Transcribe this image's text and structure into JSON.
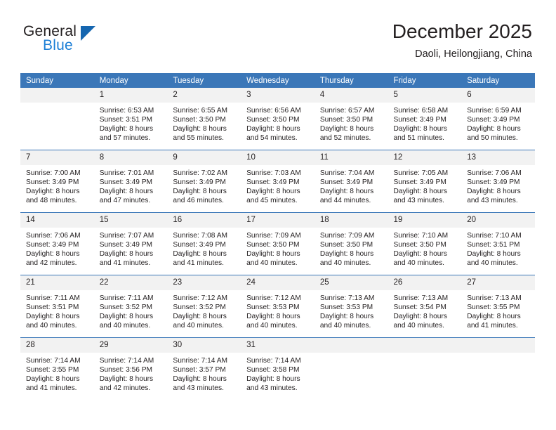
{
  "brand": {
    "name_part1": "General",
    "name_part2": "Blue",
    "accent_color": "#1c7fd6",
    "triangle_color": "#1566b0"
  },
  "header": {
    "title": "December 2025",
    "subtitle": "Daoli, Heilongjiang, China"
  },
  "theme": {
    "header_row_color": "#3b77b8",
    "daynum_band_color": "#f2f2f2",
    "text_color": "#231f20"
  },
  "weekdays": [
    "Sunday",
    "Monday",
    "Tuesday",
    "Wednesday",
    "Thursday",
    "Friday",
    "Saturday"
  ],
  "labels": {
    "sunrise_prefix": "Sunrise:",
    "sunset_prefix": "Sunset:",
    "daylight_prefix": "Daylight:"
  },
  "weeks": [
    [
      {
        "day": "",
        "blank": true
      },
      {
        "day": "1",
        "line1": "Sunrise: 6:53 AM",
        "line2": "Sunset: 3:51 PM",
        "line3": "Daylight: 8 hours",
        "line4": "and 57 minutes."
      },
      {
        "day": "2",
        "line1": "Sunrise: 6:55 AM",
        "line2": "Sunset: 3:50 PM",
        "line3": "Daylight: 8 hours",
        "line4": "and 55 minutes."
      },
      {
        "day": "3",
        "line1": "Sunrise: 6:56 AM",
        "line2": "Sunset: 3:50 PM",
        "line3": "Daylight: 8 hours",
        "line4": "and 54 minutes."
      },
      {
        "day": "4",
        "line1": "Sunrise: 6:57 AM",
        "line2": "Sunset: 3:50 PM",
        "line3": "Daylight: 8 hours",
        "line4": "and 52 minutes."
      },
      {
        "day": "5",
        "line1": "Sunrise: 6:58 AM",
        "line2": "Sunset: 3:49 PM",
        "line3": "Daylight: 8 hours",
        "line4": "and 51 minutes."
      },
      {
        "day": "6",
        "line1": "Sunrise: 6:59 AM",
        "line2": "Sunset: 3:49 PM",
        "line3": "Daylight: 8 hours",
        "line4": "and 50 minutes."
      }
    ],
    [
      {
        "day": "7",
        "line1": "Sunrise: 7:00 AM",
        "line2": "Sunset: 3:49 PM",
        "line3": "Daylight: 8 hours",
        "line4": "and 48 minutes."
      },
      {
        "day": "8",
        "line1": "Sunrise: 7:01 AM",
        "line2": "Sunset: 3:49 PM",
        "line3": "Daylight: 8 hours",
        "line4": "and 47 minutes."
      },
      {
        "day": "9",
        "line1": "Sunrise: 7:02 AM",
        "line2": "Sunset: 3:49 PM",
        "line3": "Daylight: 8 hours",
        "line4": "and 46 minutes."
      },
      {
        "day": "10",
        "line1": "Sunrise: 7:03 AM",
        "line2": "Sunset: 3:49 PM",
        "line3": "Daylight: 8 hours",
        "line4": "and 45 minutes."
      },
      {
        "day": "11",
        "line1": "Sunrise: 7:04 AM",
        "line2": "Sunset: 3:49 PM",
        "line3": "Daylight: 8 hours",
        "line4": "and 44 minutes."
      },
      {
        "day": "12",
        "line1": "Sunrise: 7:05 AM",
        "line2": "Sunset: 3:49 PM",
        "line3": "Daylight: 8 hours",
        "line4": "and 43 minutes."
      },
      {
        "day": "13",
        "line1": "Sunrise: 7:06 AM",
        "line2": "Sunset: 3:49 PM",
        "line3": "Daylight: 8 hours",
        "line4": "and 43 minutes."
      }
    ],
    [
      {
        "day": "14",
        "line1": "Sunrise: 7:06 AM",
        "line2": "Sunset: 3:49 PM",
        "line3": "Daylight: 8 hours",
        "line4": "and 42 minutes."
      },
      {
        "day": "15",
        "line1": "Sunrise: 7:07 AM",
        "line2": "Sunset: 3:49 PM",
        "line3": "Daylight: 8 hours",
        "line4": "and 41 minutes."
      },
      {
        "day": "16",
        "line1": "Sunrise: 7:08 AM",
        "line2": "Sunset: 3:49 PM",
        "line3": "Daylight: 8 hours",
        "line4": "and 41 minutes."
      },
      {
        "day": "17",
        "line1": "Sunrise: 7:09 AM",
        "line2": "Sunset: 3:50 PM",
        "line3": "Daylight: 8 hours",
        "line4": "and 40 minutes."
      },
      {
        "day": "18",
        "line1": "Sunrise: 7:09 AM",
        "line2": "Sunset: 3:50 PM",
        "line3": "Daylight: 8 hours",
        "line4": "and 40 minutes."
      },
      {
        "day": "19",
        "line1": "Sunrise: 7:10 AM",
        "line2": "Sunset: 3:50 PM",
        "line3": "Daylight: 8 hours",
        "line4": "and 40 minutes."
      },
      {
        "day": "20",
        "line1": "Sunrise: 7:10 AM",
        "line2": "Sunset: 3:51 PM",
        "line3": "Daylight: 8 hours",
        "line4": "and 40 minutes."
      }
    ],
    [
      {
        "day": "21",
        "line1": "Sunrise: 7:11 AM",
        "line2": "Sunset: 3:51 PM",
        "line3": "Daylight: 8 hours",
        "line4": "and 40 minutes."
      },
      {
        "day": "22",
        "line1": "Sunrise: 7:11 AM",
        "line2": "Sunset: 3:52 PM",
        "line3": "Daylight: 8 hours",
        "line4": "and 40 minutes."
      },
      {
        "day": "23",
        "line1": "Sunrise: 7:12 AM",
        "line2": "Sunset: 3:52 PM",
        "line3": "Daylight: 8 hours",
        "line4": "and 40 minutes."
      },
      {
        "day": "24",
        "line1": "Sunrise: 7:12 AM",
        "line2": "Sunset: 3:53 PM",
        "line3": "Daylight: 8 hours",
        "line4": "and 40 minutes."
      },
      {
        "day": "25",
        "line1": "Sunrise: 7:13 AM",
        "line2": "Sunset: 3:53 PM",
        "line3": "Daylight: 8 hours",
        "line4": "and 40 minutes."
      },
      {
        "day": "26",
        "line1": "Sunrise: 7:13 AM",
        "line2": "Sunset: 3:54 PM",
        "line3": "Daylight: 8 hours",
        "line4": "and 40 minutes."
      },
      {
        "day": "27",
        "line1": "Sunrise: 7:13 AM",
        "line2": "Sunset: 3:55 PM",
        "line3": "Daylight: 8 hours",
        "line4": "and 41 minutes."
      }
    ],
    [
      {
        "day": "28",
        "line1": "Sunrise: 7:14 AM",
        "line2": "Sunset: 3:55 PM",
        "line3": "Daylight: 8 hours",
        "line4": "and 41 minutes."
      },
      {
        "day": "29",
        "line1": "Sunrise: 7:14 AM",
        "line2": "Sunset: 3:56 PM",
        "line3": "Daylight: 8 hours",
        "line4": "and 42 minutes."
      },
      {
        "day": "30",
        "line1": "Sunrise: 7:14 AM",
        "line2": "Sunset: 3:57 PM",
        "line3": "Daylight: 8 hours",
        "line4": "and 43 minutes."
      },
      {
        "day": "31",
        "line1": "Sunrise: 7:14 AM",
        "line2": "Sunset: 3:58 PM",
        "line3": "Daylight: 8 hours",
        "line4": "and 43 minutes."
      },
      {
        "day": "",
        "blank": true
      },
      {
        "day": "",
        "blank": true
      },
      {
        "day": "",
        "blank": true
      }
    ]
  ]
}
